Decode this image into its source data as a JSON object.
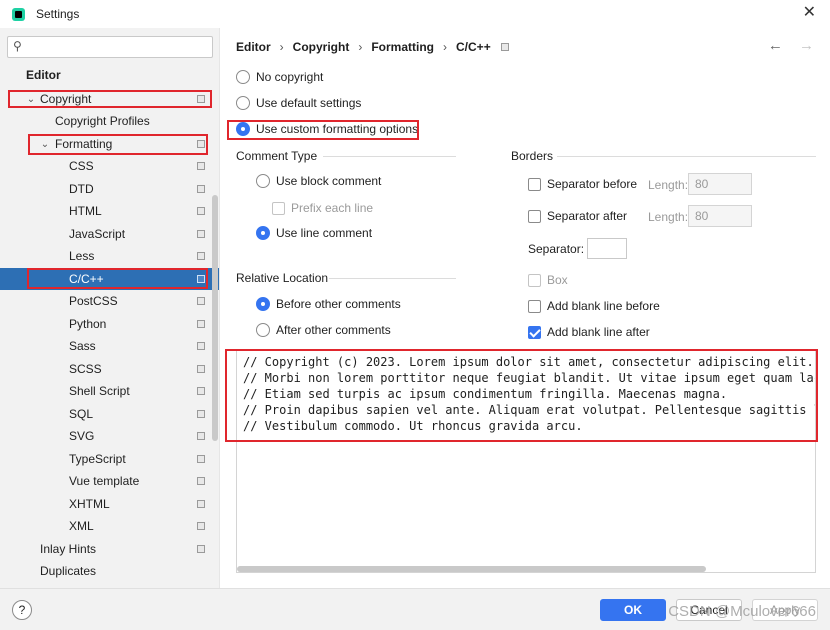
{
  "window": {
    "title": "Settings",
    "close_icon": "close-icon"
  },
  "search": {
    "placeholder": "",
    "icon": "search-icon"
  },
  "sidebar": {
    "items": [
      {
        "label": "Editor"
      },
      {
        "label": "Copyright"
      },
      {
        "label": "Copyright Profiles"
      },
      {
        "label": "Formatting"
      },
      {
        "label": "CSS"
      },
      {
        "label": "DTD"
      },
      {
        "label": "HTML"
      },
      {
        "label": "JavaScript"
      },
      {
        "label": "Less"
      },
      {
        "label": "C/C++"
      },
      {
        "label": "PostCSS"
      },
      {
        "label": "Python"
      },
      {
        "label": "Sass"
      },
      {
        "label": "SCSS"
      },
      {
        "label": "Shell Script"
      },
      {
        "label": "SQL"
      },
      {
        "label": "SVG"
      },
      {
        "label": "TypeScript"
      },
      {
        "label": "Vue template"
      },
      {
        "label": "XHTML"
      },
      {
        "label": "XML"
      },
      {
        "label": "Inlay Hints"
      },
      {
        "label": "Duplicates"
      }
    ],
    "selected": "C/C++"
  },
  "breadcrumb": [
    "Editor",
    "Copyright",
    "Formatting",
    "C/C++"
  ],
  "options": {
    "no_copyright": "No copyright",
    "use_default": "Use default settings",
    "use_custom": "Use custom formatting options",
    "selected": "Use custom formatting options"
  },
  "comment_type": {
    "title": "Comment Type",
    "block": "Use block comment",
    "prefix_each_line": "Prefix each line",
    "line": "Use line comment",
    "selected": "Use line comment"
  },
  "relative_location": {
    "title": "Relative Location",
    "before": "Before other comments",
    "after": "After other comments",
    "selected": "Before other comments"
  },
  "borders": {
    "title": "Borders",
    "separator_before": "Separator before",
    "separator_after": "Separator after",
    "length_label": "Length:",
    "length_before": "80",
    "length_after": "80",
    "separator_label": "Separator:",
    "separator_value": "",
    "box": "Box",
    "add_blank_before": "Add blank line before",
    "add_blank_after": "Add blank line after",
    "add_blank_after_checked": true
  },
  "preview": {
    "lines": [
      "// Copyright (c) 2023. Lorem ipsum dolor sit amet, consectetur adipiscing elit.",
      "// Morbi non lorem porttitor neque feugiat blandit. Ut vitae ipsum eget quam lac",
      "// Etiam sed turpis ac ipsum condimentum fringilla. Maecenas magna.",
      "// Proin dapibus sapien vel ante. Aliquam erat volutpat. Pellentesque sagittis l",
      "// Vestibulum commodo. Ut rhoncus gravida arcu."
    ]
  },
  "footer": {
    "help": "?",
    "ok": "OK",
    "cancel": "Cancel",
    "apply": "Apply",
    "watermark": "CSDN @Mculover666"
  }
}
